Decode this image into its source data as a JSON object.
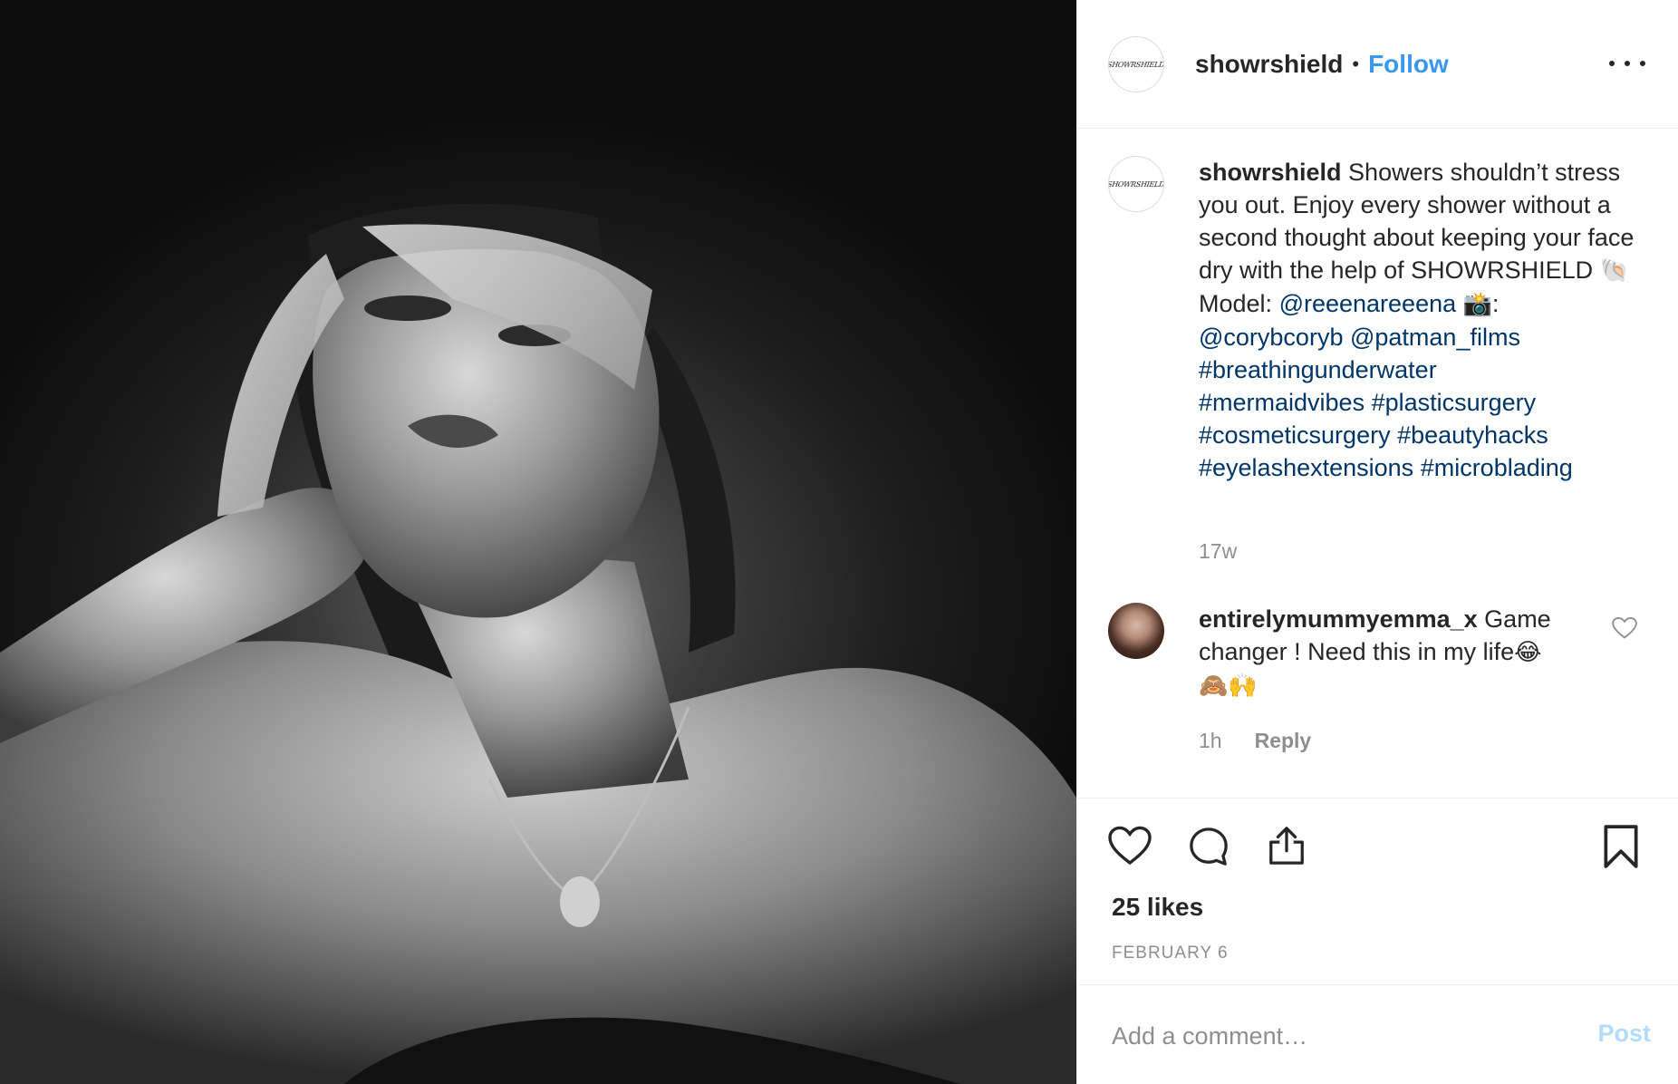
{
  "header": {
    "avatar_logo": "SHOWRSHIELD",
    "username": "showrshield",
    "separator": "•",
    "follow_label": "Follow"
  },
  "caption": {
    "username": "showrshield",
    "text_1": "Showers shouldn’t stress you out. Enjoy every shower without a second thought about keeping your face dry with the help of SHOWRSHIELD",
    "emoji_shell": "🐚",
    "model_label": "Model:",
    "mention_model": "@reeenareeena",
    "emoji_camera": "📸",
    "colon": ":",
    "mention_1": "@corybcoryb",
    "mention_2": "@patman_films",
    "hashtags": [
      "#breathingunderwater",
      "#mermaidvibes",
      "#plasticsurgery",
      "#cosmeticsurgery",
      "#beautyhacks",
      "#eyelashextensions",
      "#microblading"
    ],
    "time": "17w"
  },
  "comment": {
    "username": "entirelymummyemma_x",
    "text": "Game changer ! Need this in my life",
    "emoji_joy": "😂",
    "emoji_monkey": "🙈",
    "emoji_hands": "🙌",
    "time": "1h",
    "reply_label": "Reply"
  },
  "actions": {
    "likes": "25 likes",
    "date": "FEBRUARY 6"
  },
  "add_comment": {
    "placeholder": "Add a comment…",
    "post_label": "Post"
  },
  "colors": {
    "link": "#003569",
    "follow": "#3897f0",
    "post_disabled": "#b3dbff",
    "muted": "#8e8e8e"
  },
  "icons": [
    "more-options-icon",
    "heart-icon",
    "comment-icon",
    "share-icon",
    "bookmark-icon",
    "heart-small-icon"
  ]
}
